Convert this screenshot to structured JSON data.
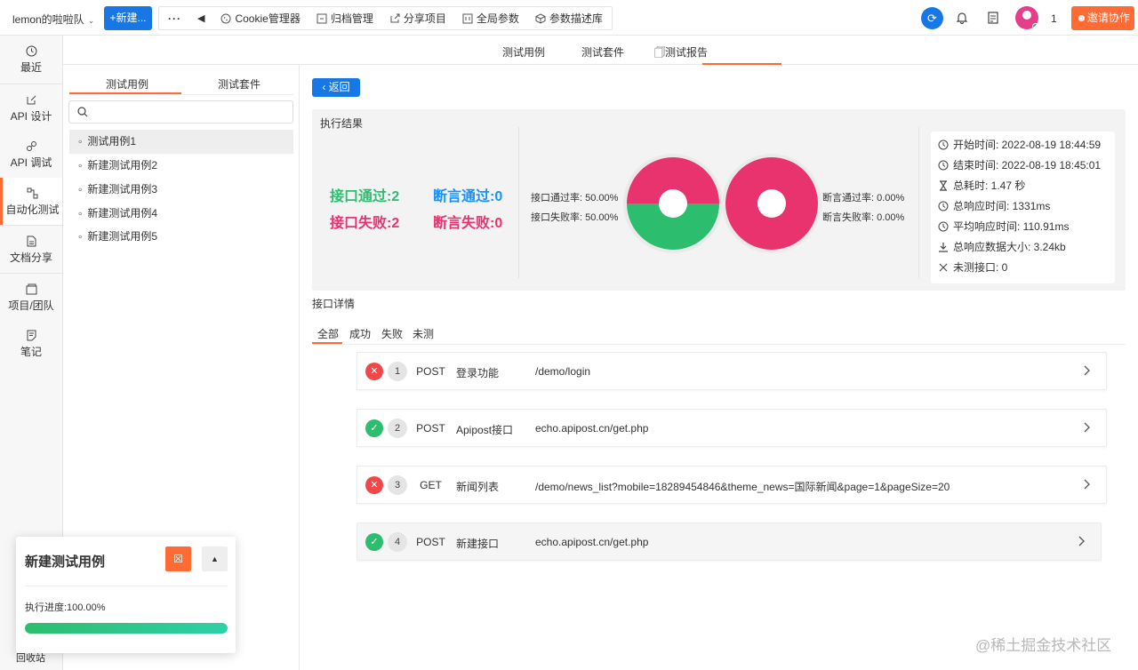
{
  "topbar": {
    "team_name": "lemon的啦啦队",
    "new_button": "+新建...",
    "toolbar_items": [
      "Cookie管理器",
      "归档管理",
      "分享项目",
      "全局参数",
      "参数描述库"
    ],
    "avatar_count": "1",
    "invite_button": "邀请协作"
  },
  "sidebar": {
    "items": [
      "最近",
      "API 设计",
      "API 调试",
      "自动化测试",
      "文档分享",
      "项目/团队",
      "笔记"
    ],
    "active": "自动化测试",
    "bottom_label": "回收站"
  },
  "subtabs": {
    "items": [
      "测试用例",
      "测试套件",
      "测试报告"
    ],
    "active": "测试报告"
  },
  "left_panel": {
    "tabs": [
      "测试用例",
      "测试套件"
    ],
    "active_tab": "测试用例",
    "search_placeholder": "",
    "cases": [
      "测试用例1",
      "新建测试用例2",
      "新建测试用例3",
      "新建测试用例4",
      "新建测试用例5"
    ],
    "selected_case": "测试用例1"
  },
  "report": {
    "back_button": "返回",
    "section_title": "执行结果",
    "api_pass": "接口通过:2",
    "api_fail": "接口失败:2",
    "assert_pass": "断言通过:0",
    "assert_fail": "断言失败:0",
    "api_pass_rate": "接口通过率:  50.00%",
    "api_fail_rate": "接口失败率:  50.00%",
    "assert_pass_rate": "断言通过率:  0.00%",
    "assert_fail_rate": "断言失败率:  0.00%",
    "api_pass_fraction": 0.5,
    "assert_pass_fraction": 0.0,
    "colors": {
      "pass": "#2dbd6e",
      "fail": "#e8336e",
      "accent": "#ff6b35",
      "primary": "#1677e5"
    },
    "info": {
      "start_time": "开始时间:  2022-08-19 18:44:59",
      "end_time": "结束时间:  2022-08-19 18:45:01",
      "total_time": "总耗时:  1.47 秒",
      "total_response": "总响应时间:   1331ms",
      "avg_response": "平均响应时间:   110.91ms",
      "total_size": "总响应数据大小:   3.24kb",
      "untested": "未测接口:   0"
    }
  },
  "details": {
    "title": "接口详情",
    "filters": [
      "全部",
      "成功",
      "失败",
      "未测"
    ],
    "active_filter": "全部",
    "rows": [
      {
        "status": "fail",
        "num": "1",
        "method": "POST",
        "name": "登录功能",
        "path": "/demo/login"
      },
      {
        "status": "ok",
        "num": "2",
        "method": "POST",
        "name": "Apipost接口",
        "path": "echo.apipost.cn/get.php"
      },
      {
        "status": "fail",
        "num": "3",
        "method": "GET",
        "name": "新闻列表",
        "path": "/demo/news_list?mobile=18289454846&theme_news=国际新闻&page=1&pageSize=20"
      },
      {
        "status": "ok",
        "num": "4",
        "method": "POST",
        "name": "新建接口",
        "path": "echo.apipost.cn/get.php"
      }
    ]
  },
  "popup": {
    "title": "新建测试用例",
    "progress_label": "执行进度:100.00%",
    "progress": 1.0
  },
  "watermark": "@稀土掘金技术社区"
}
